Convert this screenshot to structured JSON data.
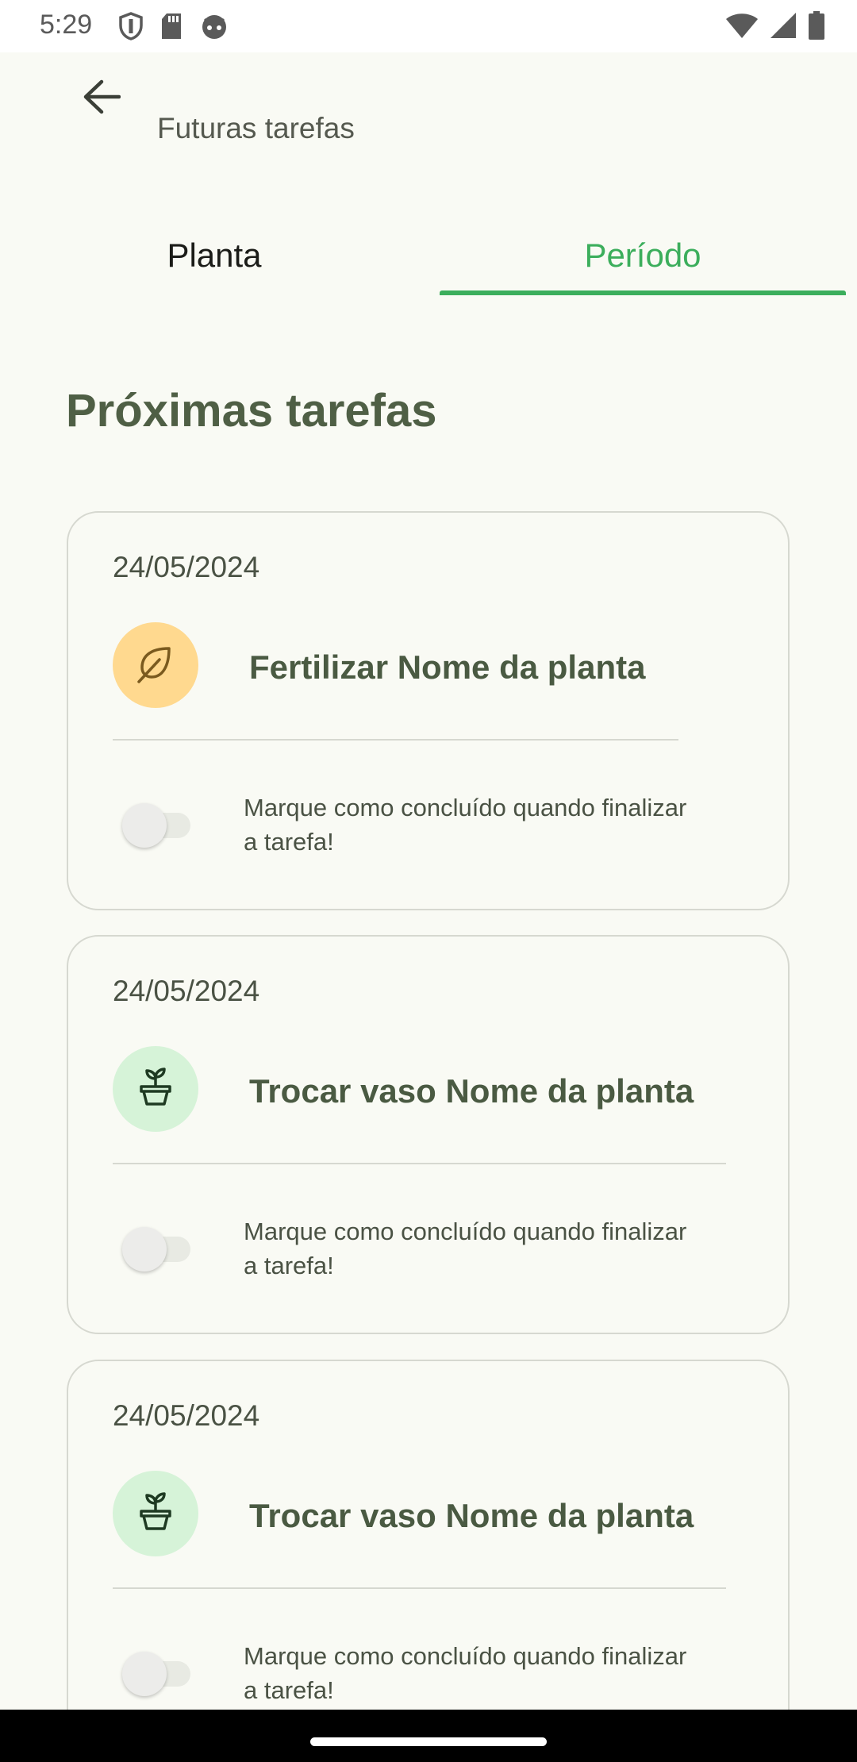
{
  "status_bar": {
    "time": "5:29",
    "left_icons": [
      "shield-icon",
      "sd-card-icon",
      "android-face-icon"
    ],
    "right_icons": [
      "wifi-icon",
      "signal-icon",
      "battery-icon"
    ]
  },
  "app_bar": {
    "back_icon": "arrow-left-icon",
    "title": "Futuras tarefas"
  },
  "tabs": [
    {
      "label": "Planta",
      "selected": false
    },
    {
      "label": "Período",
      "selected": true
    }
  ],
  "section_title": "Próximas tarefas",
  "tasks": [
    {
      "date": "24/05/2024",
      "icon": "leaf-icon",
      "title": "Fertilizar Nome da planta",
      "toggle_text": "Marque como concluído quando finalizar a tarefa!",
      "completed": false
    },
    {
      "date": "24/05/2024",
      "icon": "potted-plant-icon",
      "title": "Trocar vaso Nome da planta",
      "toggle_text": "Marque como concluído quando finalizar a tarefa!",
      "completed": false
    },
    {
      "date": "24/05/2024",
      "icon": "potted-plant-icon",
      "title": "Trocar vaso Nome da planta",
      "toggle_text": "Marque como concluído quando finalizar a tarefa!",
      "completed": false
    }
  ],
  "colors": {
    "background": "#F9FAF4",
    "accent_green": "#3CAE5C",
    "title_green": "#4F5F45",
    "fertilize_icon_bg": "#FFD98F",
    "repot_icon_bg": "#D6F3D8"
  }
}
